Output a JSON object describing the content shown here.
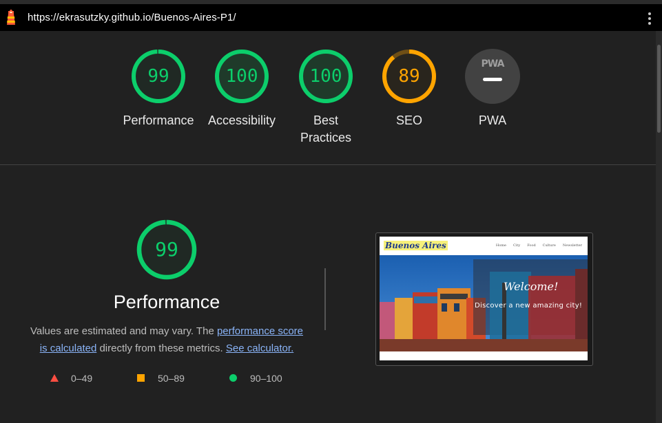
{
  "browser": {
    "url": "https://ekrasutzky.github.io/Buenos-Aires-P1/"
  },
  "categories": [
    {
      "label": "Performance",
      "score": "99",
      "status": "pass"
    },
    {
      "label": "Accessibility",
      "score": "100",
      "status": "pass"
    },
    {
      "label": "Best Practices",
      "score": "100",
      "status": "pass"
    },
    {
      "label": "SEO",
      "score": "89",
      "status": "average"
    },
    {
      "label": "PWA",
      "badge_text": "PWA",
      "status": "na"
    }
  ],
  "performance": {
    "score": "99",
    "title": "Performance",
    "desc_prefix": "Values are estimated and may vary. The ",
    "score_link": "performance score is calculated",
    "desc_middle": " directly from these metrics. ",
    "calc_link": "See calculator."
  },
  "legend": [
    {
      "range": "0–49",
      "shape": "triangle",
      "color": "#ff4e42"
    },
    {
      "range": "50–89",
      "shape": "square",
      "color": "#ffa400"
    },
    {
      "range": "90–100",
      "shape": "circle",
      "color": "#0cce6b"
    }
  ],
  "thumbnail": {
    "logo": "Buenos Aires",
    "nav": [
      "Home",
      "City",
      "Food",
      "Culture",
      "Newsletter"
    ],
    "welcome": "Welcome!",
    "subtitle": "Discover a new amazing city!"
  },
  "colors": {
    "pass": "#0cce6b",
    "average": "#ffa400",
    "fail": "#ff4e42",
    "background": "#212121"
  }
}
